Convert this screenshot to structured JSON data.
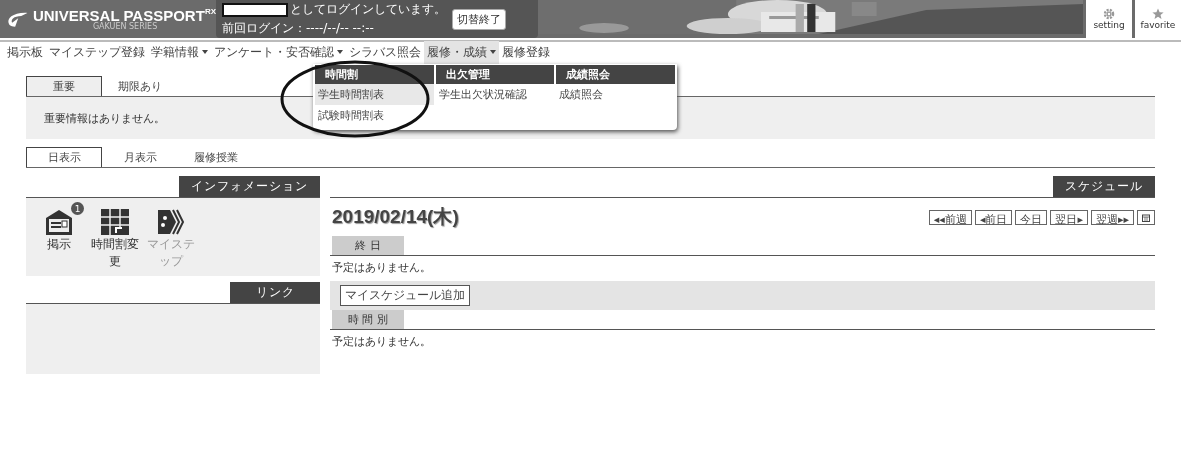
{
  "header": {
    "logo": {
      "name": "UNIVERSAL PASSPORT",
      "suffix": "RX",
      "series": "GAKUEN SERIES"
    },
    "login": {
      "message": "としてログインしています。",
      "last_login": "前回ログイン：----/--/-- --:--",
      "switch_button": "切替終了"
    },
    "buttons": [
      {
        "kind": "gear",
        "label": "setting"
      },
      {
        "kind": "star",
        "label": "favorite"
      }
    ]
  },
  "nav": [
    {
      "label": "掲示板",
      "has_menu": false,
      "selected": false
    },
    {
      "label": "マイステップ登録",
      "has_menu": false,
      "selected": false
    },
    {
      "label": "学籍情報",
      "has_menu": true,
      "selected": false
    },
    {
      "label": "アンケート・安否確認",
      "has_menu": true,
      "selected": false
    },
    {
      "label": "シラバス照会",
      "has_menu": false,
      "selected": false
    },
    {
      "label": "履修・成績",
      "has_menu": true,
      "selected": true
    },
    {
      "label": "履修登録",
      "has_menu": false,
      "selected": false
    }
  ],
  "dropdown": [
    {
      "title": "時間割",
      "items": [
        {
          "label": "学生時間割表",
          "selected": true
        },
        {
          "label": "試験時間割表",
          "selected": false
        }
      ]
    },
    {
      "title": "出欠管理",
      "items": [
        {
          "label": "学生出欠状況確認",
          "selected": false
        }
      ]
    },
    {
      "title": "成績照会",
      "items": [
        {
          "label": "成績照会",
          "selected": false
        }
      ]
    }
  ],
  "notice_tabs": [
    {
      "label": "重要",
      "selected": true
    },
    {
      "label": "期限あり",
      "selected": false
    }
  ],
  "notice_message": "重要情報はありません。",
  "view_tabs": [
    {
      "label": "日表示",
      "selected": true
    },
    {
      "label": "月表示",
      "selected": false
    },
    {
      "label": "履修授業",
      "selected": false
    }
  ],
  "information": {
    "title": "インフォメーション",
    "items": [
      {
        "kind": "board",
        "label": "掲示",
        "badge": "1",
        "disabled": false
      },
      {
        "kind": "timetable",
        "label": "時間割変更",
        "disabled": false
      },
      {
        "kind": "mystep",
        "label": "マイステップ",
        "disabled": true
      }
    ]
  },
  "links": {
    "title": "リンク"
  },
  "schedule": {
    "title": "スケジュール",
    "date": "2019/02/14(木)",
    "nav_buttons": [
      {
        "kind": "text",
        "label": "◂◂前週"
      },
      {
        "kind": "text",
        "label": "◂前日"
      },
      {
        "kind": "text",
        "label": "今日"
      },
      {
        "kind": "text",
        "label": "翌日▸"
      },
      {
        "kind": "text",
        "label": "翌週▸▸"
      },
      {
        "kind": "calendar"
      }
    ],
    "all_day": {
      "title": "終 日",
      "message": "予定はありません。"
    },
    "add_button": "マイスケジュール追加",
    "timed": {
      "title": "時 間 別",
      "message": "予定はありません。"
    }
  }
}
